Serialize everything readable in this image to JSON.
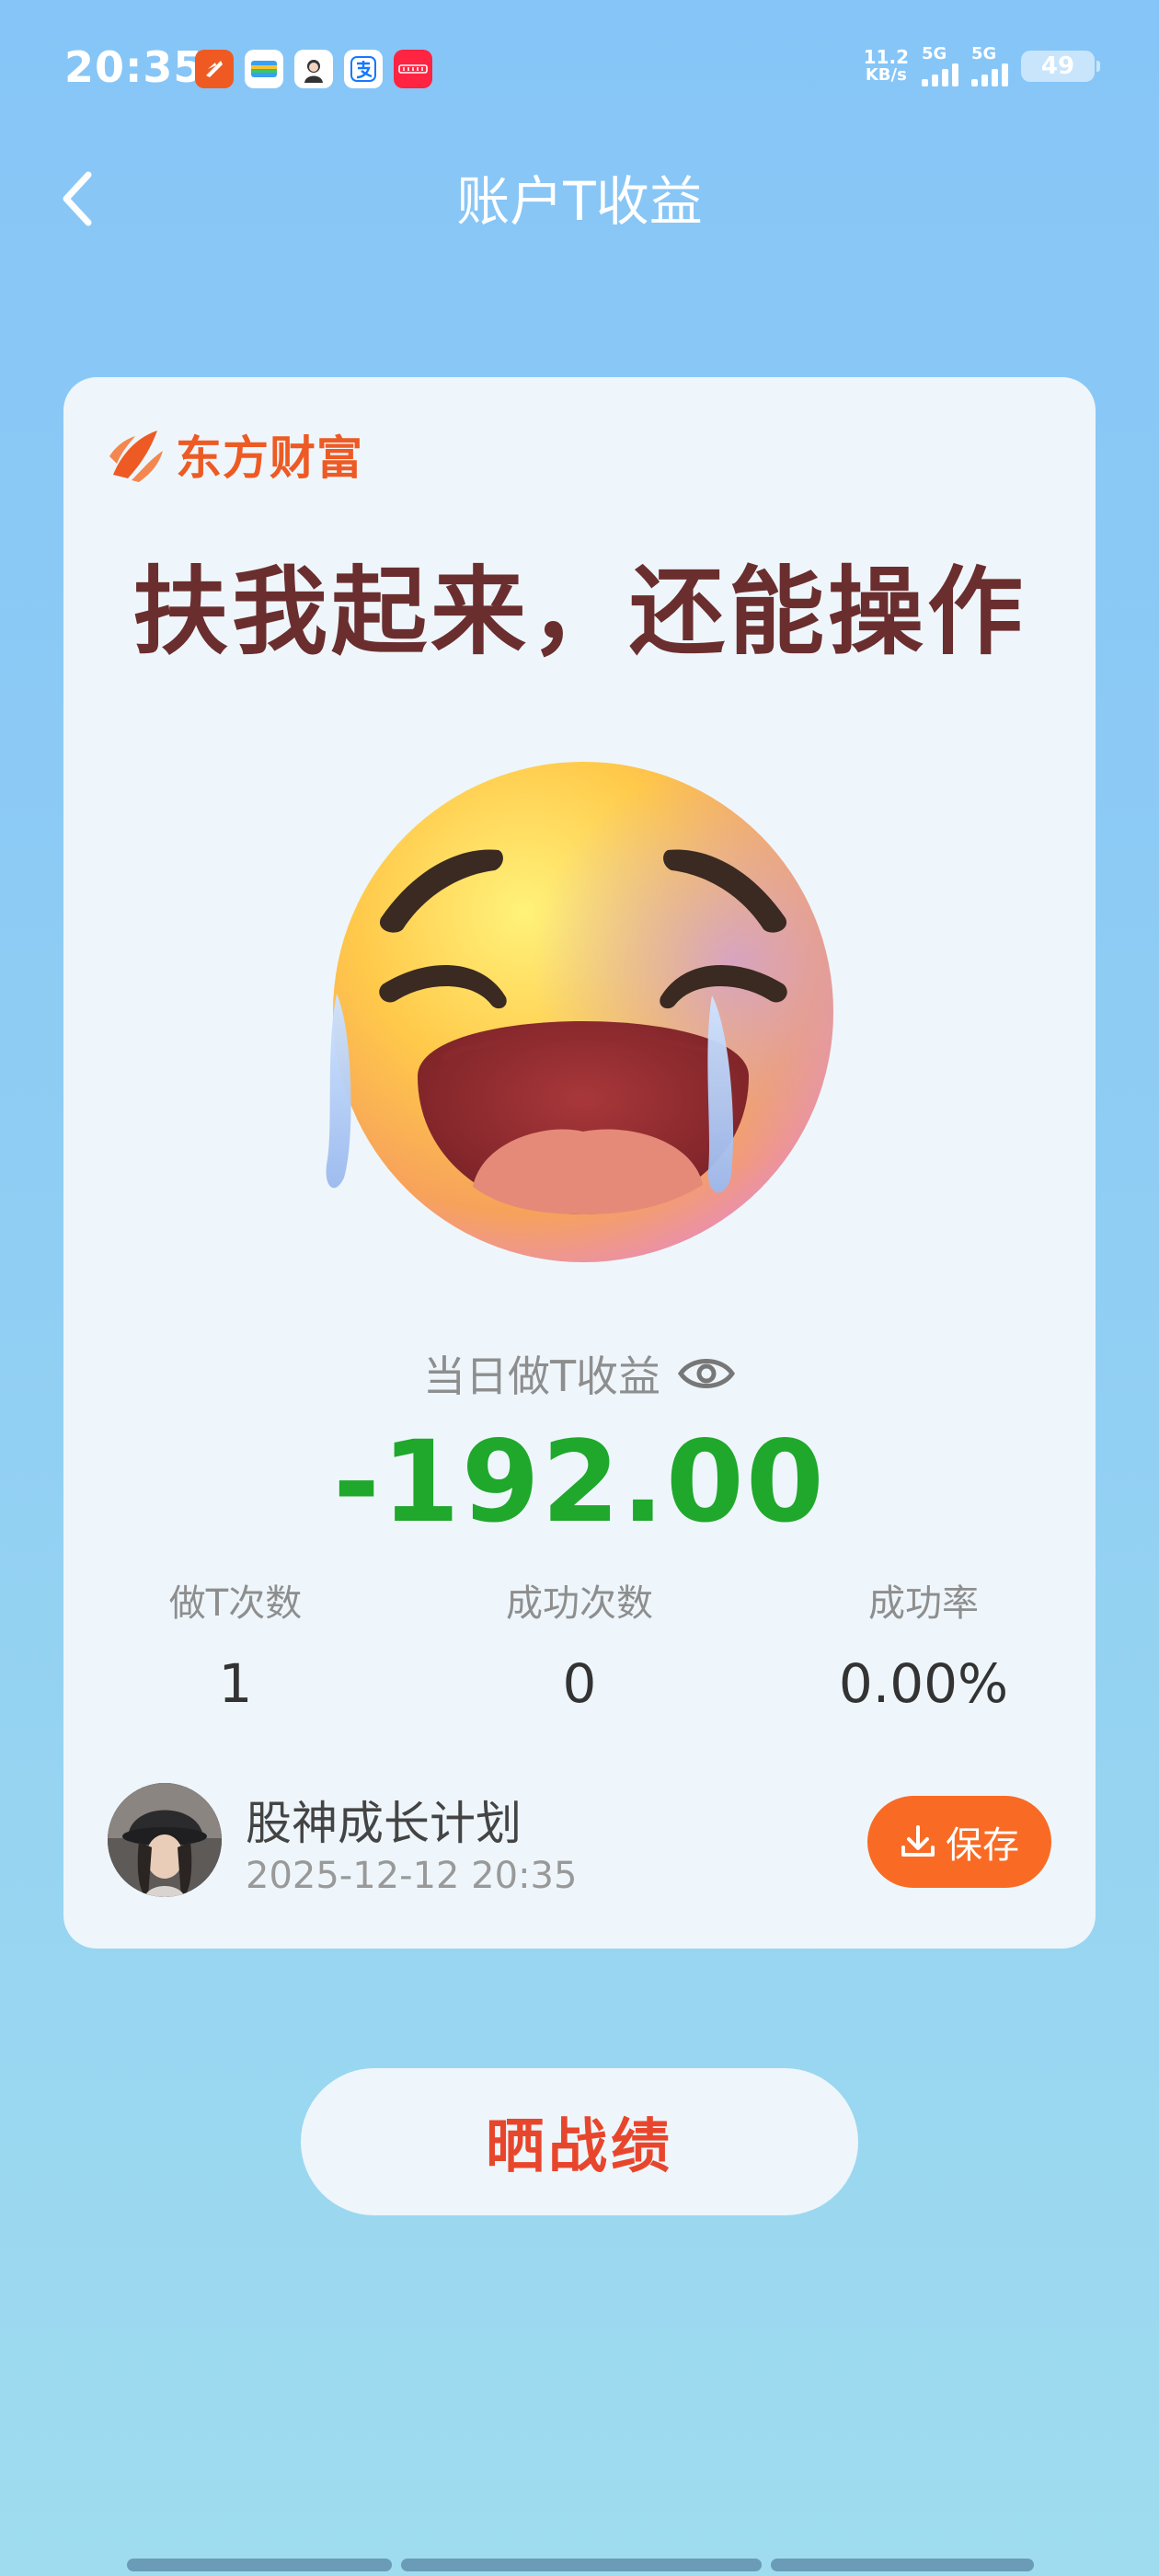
{
  "status_bar": {
    "time": "20:35",
    "net_speed_value": "11.2",
    "net_speed_unit": "KB/s",
    "sim1_label": "5G",
    "sim2_label": "5G",
    "battery": "49"
  },
  "nav": {
    "title": "账户T收益"
  },
  "card": {
    "brand_name": "东方财富",
    "headline": "扶我起来，还能操作",
    "profit_label": "当日做T收益",
    "profit_value": "-192.00",
    "stats": [
      {
        "label": "做T次数",
        "value": "1"
      },
      {
        "label": "成功次数",
        "value": "0"
      },
      {
        "label": "成功率",
        "value": "0.00%"
      }
    ],
    "user": {
      "name": "股神成长计划",
      "timestamp": "2025-12-12 20:35"
    },
    "save_label": "保存"
  },
  "share_label": "晒战绩",
  "colors": {
    "brand": "#ee5a24",
    "loss": "#1fa82b",
    "headline": "#6b2e2e",
    "save_button": "#f96b24",
    "share_text": "#e8462c"
  },
  "icons": [
    "back-arrow-icon",
    "eye-icon",
    "download-icon",
    "crying-face-emoji",
    "eastmoney-logo-icon"
  ]
}
